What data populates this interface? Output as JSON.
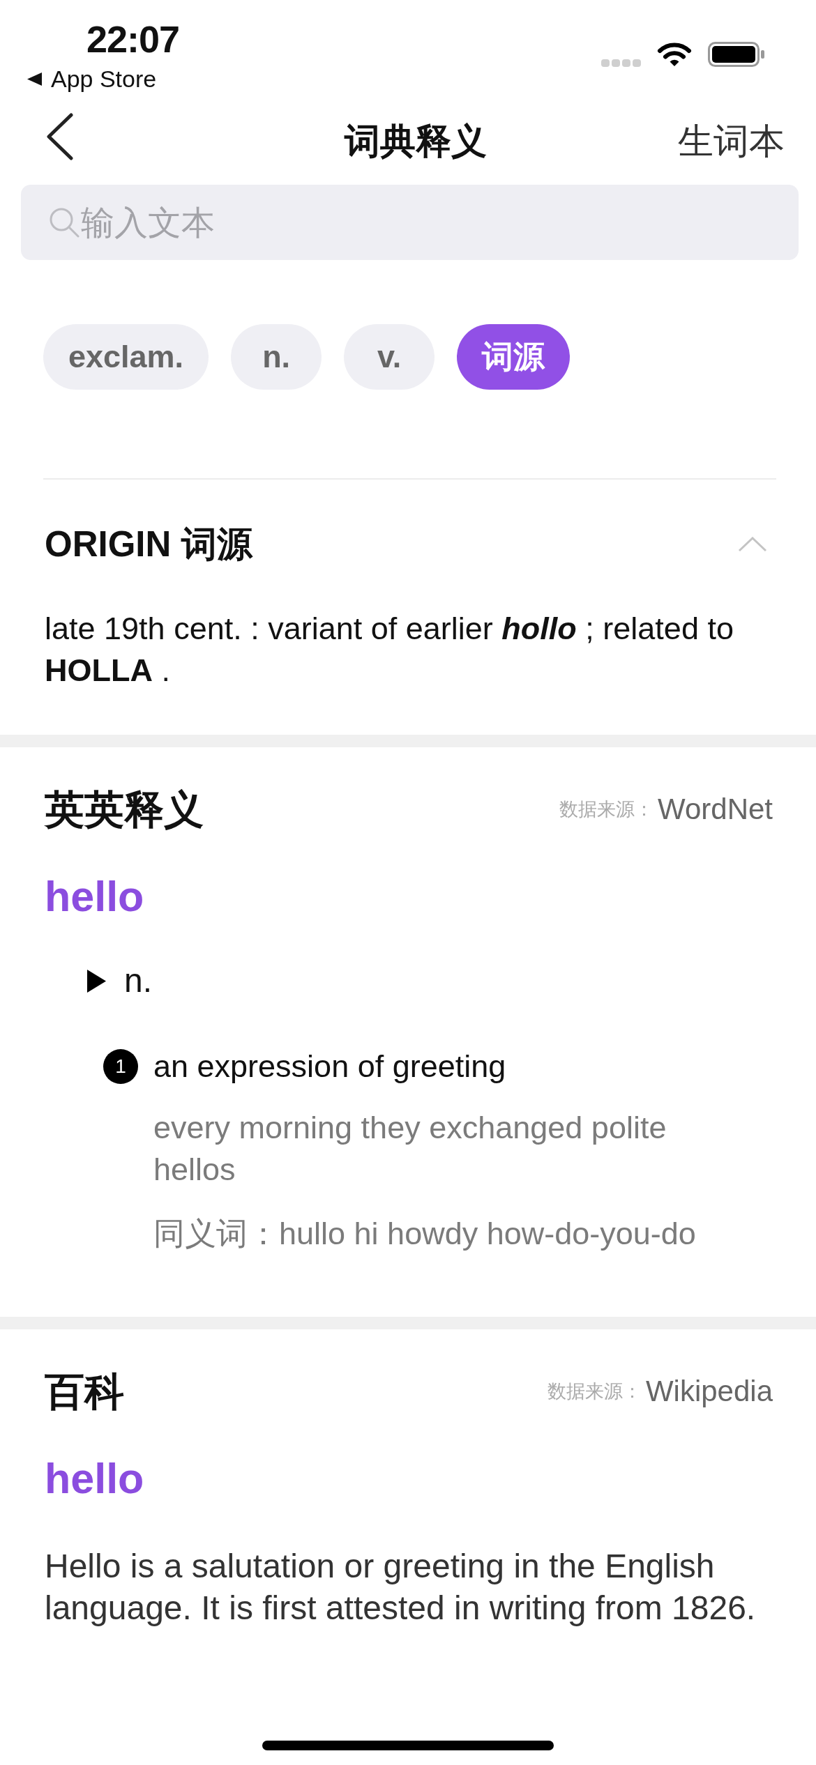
{
  "status_bar": {
    "time": "22:07",
    "back_app": "App Store"
  },
  "nav_bar": {
    "title": "词典释义",
    "action": "生词本"
  },
  "search": {
    "placeholder": "输入文本"
  },
  "tabs": [
    {
      "label": "exclam.",
      "selected": false
    },
    {
      "label": "n.",
      "selected": false
    },
    {
      "label": "v.",
      "selected": false
    },
    {
      "label": "词源",
      "selected": true
    }
  ],
  "origin": {
    "title": "ORIGIN 词源",
    "expanded": true,
    "text": "late 19th cent. : variant of earlier *hollo* ; related to **HOLLA** ."
  },
  "english_definitions": {
    "title": "英英释义",
    "source_label": "数据来源：",
    "source": "WordNet",
    "headword": "hello",
    "senses": [
      {
        "part_of_speech": "n.",
        "definitions": [
          {
            "number": "1",
            "text": "an expression of greeting",
            "example": "every morning they exchanged polite hellos",
            "synonyms_label": "同义词：",
            "synonyms": "hullo hi howdy how-do-you-do"
          }
        ]
      }
    ]
  },
  "encyclopedia": {
    "title": "百科",
    "source_label": "数据来源：",
    "source": "Wikipedia",
    "headword": "hello",
    "text": "Hello is a salutation or greeting in the English language. It is first attested in writing from 1826."
  }
}
